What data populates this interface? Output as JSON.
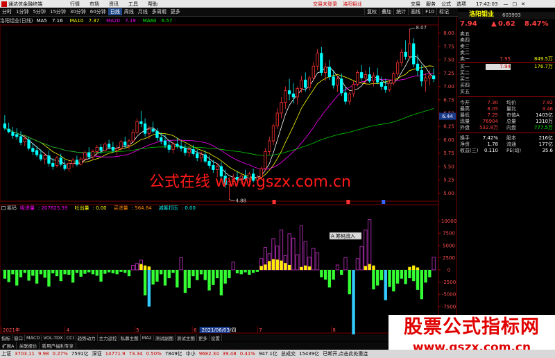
{
  "window": {
    "title": "通达信金融终端",
    "menus": [
      "行情",
      "市场",
      "资讯",
      "工具",
      "帮助"
    ],
    "status_link": "交易未登录",
    "stock_title": "洛阳钼业",
    "right_menus": [
      "交易",
      "服务",
      "公式",
      "选项"
    ],
    "clock": "17:42:03"
  },
  "toolbar": {
    "periods": [
      "分时",
      "1分钟",
      "5分钟",
      "15分钟",
      "30分钟",
      "60分钟",
      "日线",
      "周线",
      "月线",
      "多周期",
      "更多"
    ],
    "selected": "日线",
    "right_items": [
      "复权",
      "叠加",
      "统计",
      "画线",
      "F10",
      "标记"
    ]
  },
  "main_info": {
    "label": "洛阳钼业(日线)",
    "ma": [
      {
        "name": "MA5",
        "value": "7.16",
        "color": "#ffffff"
      },
      {
        "name": "MA10",
        "value": "7.37",
        "color": "#ffff00"
      },
      {
        "name": "MA20",
        "value": "7.19",
        "color": "#ff00ff"
      },
      {
        "name": "MA60",
        "value": "6.57",
        "color": "#00ff00"
      }
    ]
  },
  "vol_info": {
    "label": "筹码",
    "items": [
      {
        "name": "吸进量",
        "value": "207625.59",
        "color": "#ff00ff"
      },
      {
        "name": "吐出量",
        "value": "0.00",
        "color": "#ffff00"
      },
      {
        "name": "买进量",
        "value": "564.84",
        "color": "#ff8800"
      },
      {
        "name": "减筹打压",
        "value": "0.00",
        "color": "#00ffff"
      }
    ]
  },
  "axis": {
    "price_ticks": [
      "8.00",
      "7.75",
      "7.50",
      "7.25",
      "7.00",
      "6.75",
      "6.50",
      "6.25",
      "6.00",
      "5.75",
      "5.50",
      "5.25",
      "5.00"
    ],
    "current_price_label": "6.44",
    "vol_ticks": [
      "10000",
      "7500",
      "5000",
      "2500",
      "0",
      "-2500",
      "-5000",
      "-7500",
      "-10000"
    ],
    "date_labels": [
      {
        "text": "2021年",
        "pos": 0.0
      },
      {
        "text": "4",
        "pos": 0.146
      },
      {
        "text": "5",
        "pos": 0.306
      },
      {
        "text": "6",
        "pos": 0.438
      },
      {
        "text": "7",
        "pos": 0.588
      },
      {
        "text": "8",
        "pos": 0.757
      }
    ],
    "cursor_date": "2021/06/03/四",
    "max_label": "8.07",
    "min_label": "4.88",
    "popup": "A 筹码流入"
  },
  "chart_data": {
    "type": "candlestick",
    "ylim": [
      4.85,
      8.15
    ],
    "vol_ylim": [
      -11500,
      11500
    ],
    "ohlc": [
      [
        6.3,
        6.46,
        6.18,
        6.22
      ],
      [
        6.2,
        6.32,
        6.12,
        6.15
      ],
      [
        6.14,
        6.24,
        6.02,
        6.08
      ],
      [
        6.1,
        6.22,
        6.0,
        6.06
      ],
      [
        6.06,
        6.16,
        5.9,
        5.95
      ],
      [
        5.96,
        6.08,
        5.88,
        6.02
      ],
      [
        6.0,
        6.06,
        5.8,
        5.84
      ],
      [
        5.84,
        5.94,
        5.72,
        5.78
      ],
      [
        5.8,
        5.88,
        5.68,
        5.72
      ],
      [
        5.72,
        5.82,
        5.6,
        5.64
      ],
      [
        5.64,
        5.76,
        5.54,
        5.7
      ],
      [
        5.7,
        5.8,
        5.5,
        5.56
      ],
      [
        5.56,
        5.66,
        5.44,
        5.5
      ],
      [
        5.52,
        5.7,
        5.48,
        5.66
      ],
      [
        5.66,
        5.74,
        5.5,
        5.54
      ],
      [
        5.52,
        5.62,
        5.42,
        5.46
      ],
      [
        5.46,
        5.6,
        5.4,
        5.56
      ],
      [
        5.56,
        5.66,
        5.48,
        5.62
      ],
      [
        5.62,
        5.7,
        5.5,
        5.54
      ],
      [
        5.54,
        5.68,
        5.52,
        5.64
      ],
      [
        5.64,
        5.8,
        5.6,
        5.76
      ],
      [
        5.76,
        5.86,
        5.64,
        5.68
      ],
      [
        5.68,
        5.82,
        5.62,
        5.78
      ],
      [
        5.78,
        5.9,
        5.7,
        5.86
      ],
      [
        5.86,
        5.92,
        5.74,
        5.8
      ],
      [
        5.8,
        5.96,
        5.78,
        5.92
      ],
      [
        5.92,
        6.0,
        5.82,
        5.86
      ],
      [
        5.86,
        5.96,
        5.76,
        5.8
      ],
      [
        5.8,
        5.9,
        5.7,
        5.84
      ],
      [
        5.84,
        6.0,
        5.8,
        5.96
      ],
      [
        5.96,
        6.06,
        5.84,
        5.9
      ],
      [
        5.9,
        6.02,
        5.82,
        5.98
      ],
      [
        5.98,
        6.2,
        5.94,
        6.14
      ],
      [
        6.14,
        6.4,
        6.1,
        6.34
      ],
      [
        6.34,
        6.54,
        6.24,
        6.3
      ],
      [
        6.3,
        6.4,
        6.06,
        6.12
      ],
      [
        6.12,
        6.26,
        6.02,
        6.2
      ],
      [
        6.2,
        6.34,
        6.12,
        6.16
      ],
      [
        6.16,
        6.22,
        5.98,
        6.04
      ],
      [
        6.04,
        6.14,
        5.92,
        5.98
      ],
      [
        5.98,
        6.1,
        5.84,
        5.9
      ],
      [
        5.9,
        6.0,
        5.76,
        5.82
      ],
      [
        5.82,
        5.96,
        5.74,
        5.92
      ],
      [
        5.92,
        6.04,
        5.84,
        5.88
      ],
      [
        5.88,
        5.98,
        5.78,
        5.84
      ],
      [
        5.84,
        5.92,
        5.7,
        5.76
      ],
      [
        5.76,
        5.88,
        5.68,
        5.82
      ],
      [
        5.82,
        5.9,
        5.7,
        5.74
      ],
      [
        5.74,
        5.82,
        5.6,
        5.66
      ],
      [
        5.66,
        5.78,
        5.58,
        5.72
      ],
      [
        5.72,
        5.8,
        5.56,
        5.6
      ],
      [
        5.6,
        5.7,
        5.46,
        5.52
      ],
      [
        5.52,
        5.62,
        5.38,
        5.44
      ],
      [
        5.44,
        5.56,
        5.3,
        5.5
      ],
      [
        5.5,
        5.58,
        5.26,
        5.32
      ],
      [
        5.32,
        5.44,
        5.1,
        5.16
      ],
      [
        5.16,
        5.3,
        4.88,
        5.22
      ],
      [
        5.22,
        5.36,
        5.14,
        5.3
      ],
      [
        5.3,
        5.4,
        5.2,
        5.26
      ],
      [
        5.26,
        5.36,
        5.16,
        5.32
      ],
      [
        5.32,
        5.44,
        5.24,
        5.28
      ],
      [
        5.28,
        5.4,
        5.2,
        5.36
      ],
      [
        5.36,
        5.46,
        5.2,
        5.24
      ],
      [
        5.24,
        5.34,
        5.16,
        5.3
      ],
      [
        5.3,
        5.5,
        5.26,
        5.46
      ],
      [
        5.46,
        5.84,
        5.42,
        5.78
      ],
      [
        5.78,
        6.06,
        5.72,
        5.98
      ],
      [
        5.98,
        6.3,
        5.9,
        6.26
      ],
      [
        6.26,
        6.6,
        6.2,
        6.5
      ],
      [
        6.5,
        6.8,
        6.4,
        6.7
      ],
      [
        6.7,
        7.0,
        6.58,
        6.92
      ],
      [
        6.92,
        7.14,
        6.74,
        6.86
      ],
      [
        6.86,
        7.06,
        6.68,
        6.8
      ],
      [
        6.8,
        7.0,
        6.66,
        6.96
      ],
      [
        6.96,
        7.2,
        6.88,
        7.12
      ],
      [
        7.12,
        7.26,
        6.9,
        6.98
      ],
      [
        6.98,
        7.2,
        6.92,
        7.16
      ],
      [
        7.16,
        7.46,
        7.1,
        7.38
      ],
      [
        7.38,
        7.7,
        7.3,
        7.62
      ],
      [
        7.62,
        7.74,
        7.2,
        7.26
      ],
      [
        7.26,
        7.44,
        7.1,
        7.36
      ],
      [
        7.36,
        7.5,
        7.12,
        7.18
      ],
      [
        7.18,
        7.3,
        6.96,
        7.02
      ],
      [
        7.02,
        7.2,
        6.9,
        7.14
      ],
      [
        7.14,
        7.24,
        6.82,
        6.88
      ],
      [
        6.88,
        7.0,
        6.66,
        6.72
      ],
      [
        6.72,
        6.9,
        6.66,
        6.86
      ],
      [
        6.86,
        7.1,
        6.8,
        7.04
      ],
      [
        7.04,
        7.3,
        7.0,
        7.26
      ],
      [
        7.26,
        7.4,
        7.1,
        7.16
      ],
      [
        7.16,
        7.3,
        7.04,
        7.22
      ],
      [
        7.22,
        7.36,
        7.06,
        7.1
      ],
      [
        7.1,
        7.26,
        7.0,
        7.2
      ],
      [
        7.2,
        7.34,
        7.04,
        7.08
      ],
      [
        7.08,
        7.18,
        6.94,
        7.0
      ],
      [
        7.0,
        7.14,
        6.88,
        6.94
      ],
      [
        6.94,
        7.1,
        6.9,
        7.06
      ],
      [
        7.06,
        7.28,
        7.02,
        7.24
      ],
      [
        7.24,
        7.5,
        7.18,
        7.44
      ],
      [
        7.44,
        7.7,
        7.38,
        7.64
      ],
      [
        7.64,
        7.86,
        7.5,
        7.56
      ],
      [
        7.56,
        8.07,
        7.52,
        7.8
      ],
      [
        7.8,
        7.9,
        7.36,
        7.42
      ],
      [
        7.42,
        7.6,
        7.2,
        7.3
      ],
      [
        7.3,
        7.4,
        7.0,
        7.1
      ],
      [
        7.1,
        7.24,
        6.9,
        7.16
      ],
      [
        7.16,
        7.3,
        7.02,
        7.2
      ],
      [
        7.2,
        7.34,
        7.08,
        7.14
      ]
    ],
    "vol_values": [
      -1800,
      -2500,
      -900,
      -3200,
      -1500,
      -600,
      -2200,
      -1200,
      -2800,
      -900,
      -1600,
      -3400,
      -700,
      -1300,
      -2300,
      -900,
      -1000,
      -2600,
      -600,
      -1400,
      -800,
      -500,
      -900,
      -1200,
      -2400,
      -800,
      -500,
      -700,
      -900,
      -400,
      -600,
      -1300,
      900,
      1300,
      2000,
      -5200,
      -7500,
      -3000,
      -2400,
      -900,
      -3200,
      -1700,
      -600,
      -3600,
      2500,
      -4700,
      -3700,
      -1300,
      -2100,
      -900,
      -2100,
      -4200,
      -3100,
      -1700,
      -5200,
      -2800,
      -1700,
      1600,
      -700,
      -900,
      -500,
      -1000,
      -600,
      -400,
      2300,
      4600,
      3300,
      6400,
      4900,
      8200,
      2900,
      7400,
      6500,
      3100,
      9000,
      5800,
      2600,
      4400,
      3500,
      -1500,
      -2000,
      -3600,
      -2000,
      1000,
      -1000,
      2500,
      -5000,
      -16200,
      2300,
      4800,
      8200,
      10300,
      -4000,
      -3200,
      -2100,
      -6200,
      -3500,
      -4400,
      -2800,
      -1800,
      -2900,
      -1700,
      -2300,
      -4100,
      -6000,
      -2600,
      -1500,
      2600,
      1300,
      2800
    ],
    "yellow_values": [
      {
        "i": 34,
        "v": 1200
      },
      {
        "i": 35,
        "v": 900
      },
      {
        "i": 36,
        "v": 700
      },
      {
        "i": 64,
        "v": 800
      },
      {
        "i": 65,
        "v": 1100
      },
      {
        "i": 66,
        "v": 1800
      },
      {
        "i": 67,
        "v": 2200
      },
      {
        "i": 68,
        "v": 2100
      },
      {
        "i": 69,
        "v": 1900
      },
      {
        "i": 70,
        "v": 1400
      },
      {
        "i": 71,
        "v": 1000
      },
      {
        "i": 74,
        "v": 600
      },
      {
        "i": 75,
        "v": 900
      },
      {
        "i": 76,
        "v": 700
      },
      {
        "i": 90,
        "v": 800
      },
      {
        "i": 91,
        "v": 1200
      },
      {
        "i": 92,
        "v": 900
      },
      {
        "i": 101,
        "v": 600
      },
      {
        "i": 102,
        "v": 900
      },
      {
        "i": 103,
        "v": 500
      }
    ]
  },
  "panel": {
    "code_name": "洛阳钼业",
    "code": "603993",
    "last": "7.94",
    "change": "0.62",
    "change_pct": "8.47%",
    "asks": [
      {
        "label": "卖五",
        "price": "",
        "vol": ""
      },
      {
        "label": "卖四",
        "price": "",
        "vol": ""
      },
      {
        "label": "卖三",
        "price": "",
        "vol": ""
      },
      {
        "label": "卖二",
        "price": "",
        "vol": ""
      },
      {
        "label": "卖一",
        "price": "7.95",
        "vol": "849.5万"
      }
    ],
    "bids": [
      {
        "label": "买一",
        "price": "7.94",
        "vol": "176.7万"
      },
      {
        "label": "买二",
        "price": "",
        "vol": ""
      },
      {
        "label": "买三",
        "price": "",
        "vol": ""
      },
      {
        "label": "买四",
        "price": "",
        "vol": ""
      },
      {
        "label": "买五",
        "price": "",
        "vol": ""
      }
    ],
    "stats": [
      {
        "k": "今开",
        "v": "7.30",
        "vc": "#ff4040",
        "k2": "均价",
        "v2": "7.92",
        "v2c": "#ff4040"
      },
      {
        "k": "最高",
        "v": "8.05",
        "vc": "#ff4040",
        "k2": "量比",
        "v2": "3.46",
        "v2c": "#ff4040"
      },
      {
        "k": "最低",
        "v": "7.25",
        "vc": "#ff4040",
        "k2": "市值A",
        "v2": "1403亿",
        "v2c": "#ffffff"
      },
      {
        "k": "现量",
        "v": "76904",
        "vc": "#ff4040",
        "k2": "总量",
        "v2": "1310万",
        "v2c": "#ffffff"
      },
      {
        "k": "外盘",
        "v": "532.8万",
        "vc": "#ff4040",
        "k2": "内盘",
        "v2": "777.5万",
        "v2c": "#00ff00"
      }
    ],
    "stats2": [
      {
        "k": "换手",
        "v": "7.42%",
        "vc": "#ffffff",
        "k2": "股本",
        "v2": "216亿",
        "v2c": "#ffffff"
      },
      {
        "k": "净资",
        "v": "1.78",
        "vc": "#ffffff",
        "k2": "流通",
        "v2": "177亿",
        "v2c": "#ffffff"
      },
      {
        "k": "收益(三)",
        "v": "0.110",
        "vc": "#ffffff",
        "k2": "PE(动)",
        "v2": "35.6",
        "v2c": "#ffffff"
      }
    ]
  },
  "bottom_tabs": [
    "指标",
    "窗口",
    "MACD",
    "VOL-TDX",
    "CCI",
    "趋势动力",
    "主力运控",
    "私募主图",
    "MA2",
    "测试副图",
    "测试主图",
    "更多",
    "设置"
  ],
  "bottom_tabs2": [
    "扩展A",
    "关联报价",
    "新用户福利专享"
  ],
  "statusbar": [
    {
      "text": "上证",
      "c": "#000"
    },
    {
      "text": "3703.11",
      "c": "#d00000"
    },
    {
      "text": "9.98",
      "c": "#d00000"
    },
    {
      "text": "0.27%",
      "c": "#d00000"
    },
    {
      "text": "7591亿",
      "c": "#000"
    },
    {
      "text": "深证",
      "c": "#000"
    },
    {
      "text": "14771.9",
      "c": "#d00000"
    },
    {
      "text": "73.34",
      "c": "#d00000"
    },
    {
      "text": "0.50%",
      "c": "#d00000"
    },
    {
      "text": "7849亿",
      "c": "#000"
    },
    {
      "text": "中小",
      "c": "#000"
    },
    {
      "text": "9682.34",
      "c": "#d00000"
    },
    {
      "text": "39.48",
      "c": "#d00000"
    },
    {
      "text": "0.41%",
      "c": "#d00000"
    },
    {
      "text": "947.1亿",
      "c": "#000"
    },
    {
      "text": "总成交",
      "c": "#000"
    },
    {
      "text": "15439亿",
      "c": "#000"
    },
    {
      "text": "已断开,点击此处重连",
      "c": "#000"
    }
  ],
  "watermark": "公式在线 www.gszx.com.cn",
  "ad": {
    "line1": "股票公式指标网",
    "line2": "www.gszx.com.cn"
  }
}
